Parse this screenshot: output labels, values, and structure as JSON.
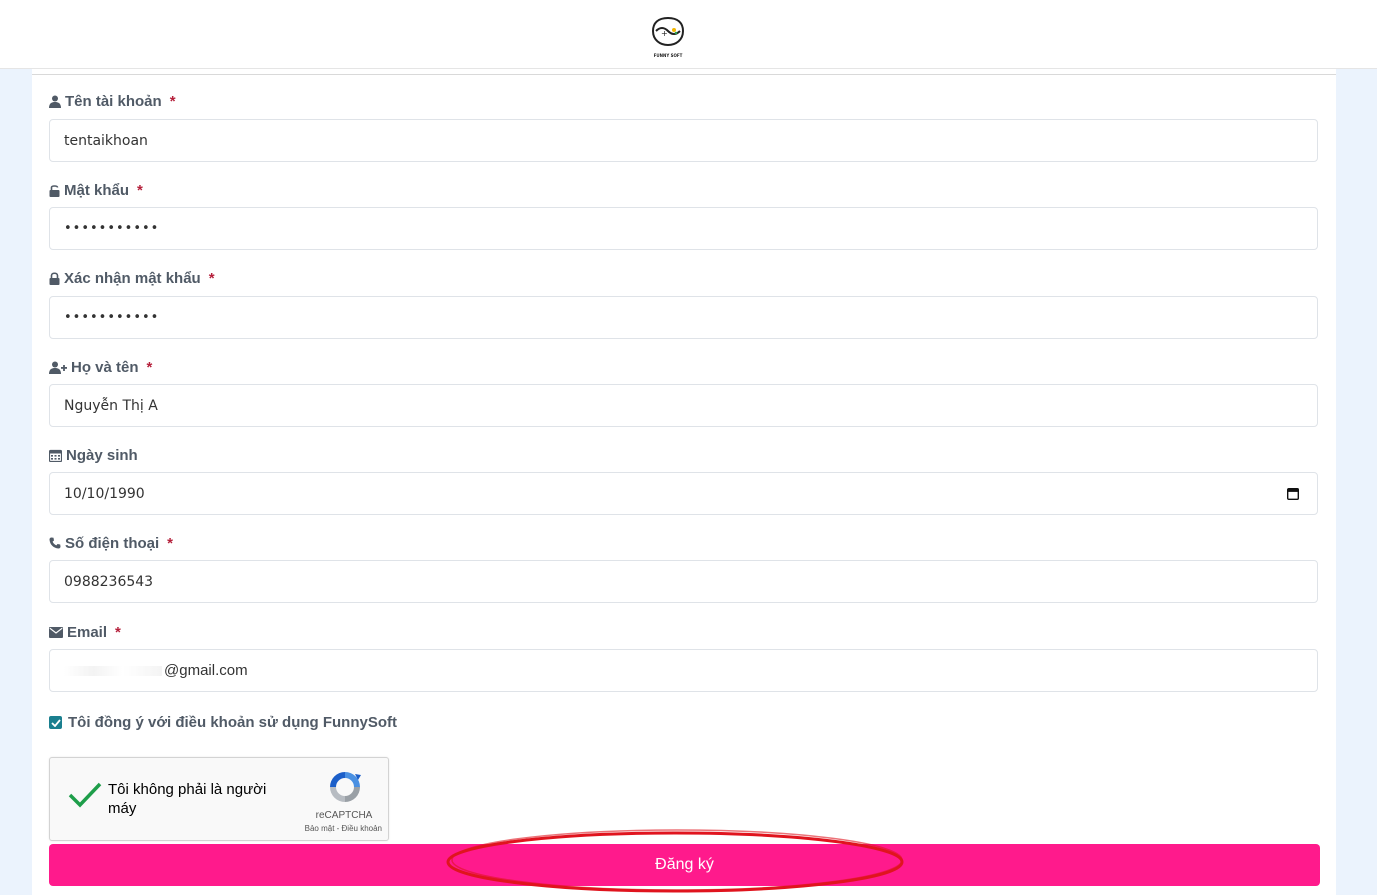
{
  "header": {
    "logo_text": "FUNNY SOFT"
  },
  "form": {
    "username": {
      "label": "Tên tài khoản",
      "required": "*",
      "value": "tentaikhoan",
      "icon": "user-icon"
    },
    "password": {
      "label": "Mật khẩu",
      "required": "*",
      "value": "•••••••••••",
      "icon": "unlock-icon"
    },
    "confirm_password": {
      "label": "Xác nhận mật khẩu",
      "required": "*",
      "value": "•••••••••••",
      "icon": "lock-icon"
    },
    "full_name": {
      "label": "Họ và tên",
      "required": "*",
      "value": "Nguyễn Thị A",
      "icon": "user-plus-icon"
    },
    "birthday": {
      "label": "Ngày sinh",
      "value": "10/10/1990",
      "icon": "calendar-icon"
    },
    "phone": {
      "label": "Số điện thoại",
      "required": "*",
      "value": "0988236543",
      "icon": "phone-icon"
    },
    "email": {
      "label": "Email",
      "required": "*",
      "value": "@gmail.com",
      "icon": "envelope-icon"
    },
    "terms": {
      "label": "Tôi đồng ý với điều khoản sử dụng FunnySoft",
      "checked": true
    },
    "recaptcha": {
      "text": "Tôi không phải là người máy",
      "brand": "reCAPTCHA",
      "terms": "Bảo mật - Điều khoản"
    },
    "submit_label": "Đăng ký"
  },
  "colors": {
    "page_bg": "#ebf3fd",
    "label": "#505a66",
    "required": "#b5203b",
    "submit_bg": "#ff1a8c",
    "annotation": "#e0141e"
  }
}
